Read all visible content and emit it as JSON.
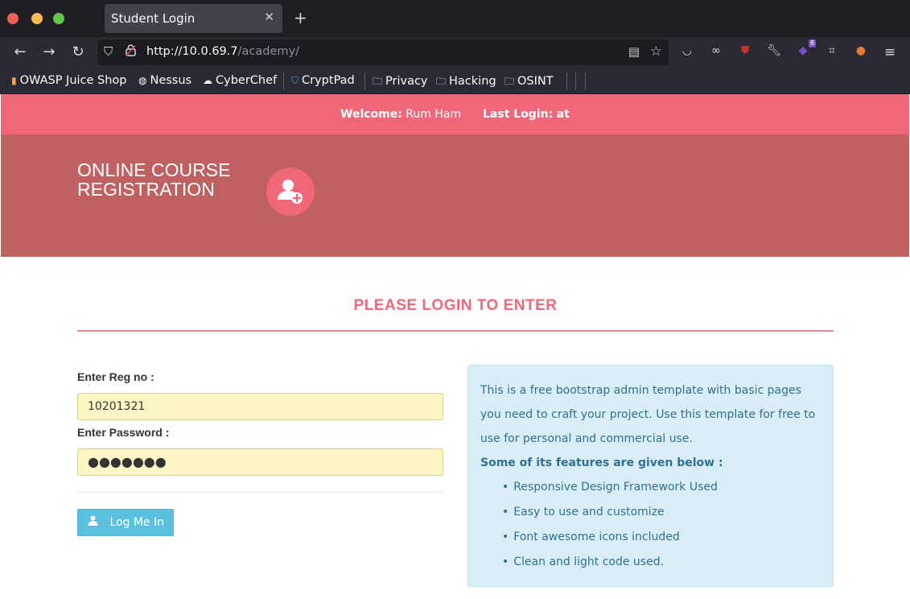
{
  "browser": {
    "tab_title": "Student Login",
    "tab_close": "✕",
    "new_tab": "+",
    "url_host": "http://10.0.69.7",
    "url_path": "/academy/",
    "extension_badge": "8",
    "bookmarks": [
      {
        "label": "OWASP Juice Shop",
        "icon": "juice-icon"
      },
      {
        "label": "Nessus",
        "icon": "globe-icon"
      },
      {
        "label": "CyberChef",
        "icon": "chef-icon"
      },
      {
        "label": "CryptPad",
        "icon": "cryptpad-icon"
      },
      {
        "label": "Privacy",
        "icon": "folder-icon"
      },
      {
        "label": "Hacking",
        "icon": "folder-icon"
      },
      {
        "label": "OSINT",
        "icon": "folder-icon"
      }
    ]
  },
  "topstrip": {
    "welcome_label": "Welcome:",
    "welcome_name": "Rum Ham",
    "last_login_label": "Last Login:",
    "last_login_value": "at"
  },
  "header": {
    "brand_line1": "ONLINE COURSE",
    "brand_line2": "REGISTRATION"
  },
  "login": {
    "title": "PLEASE LOGIN TO ENTER",
    "regno_label": "Enter Reg no :",
    "regno_value": "10201321",
    "password_label": "Enter Password :",
    "password_value": "●●●●●●●",
    "button_label": "Log Me In"
  },
  "info": {
    "text": "This is a free bootstrap admin template with basic pages you need to craft your project. Use this template for free to use for personal and commercial use.",
    "features_heading": "Some of its features are given below :",
    "features": [
      "Responsive Design Framework Used",
      "Easy to use and customize",
      "Font awesome icons included",
      "Clean and light code used."
    ]
  },
  "colors": {
    "accent": "#f0677a",
    "header_bg": "#bf6161",
    "info_bg": "#d9edf7",
    "button": "#5bc0de"
  }
}
